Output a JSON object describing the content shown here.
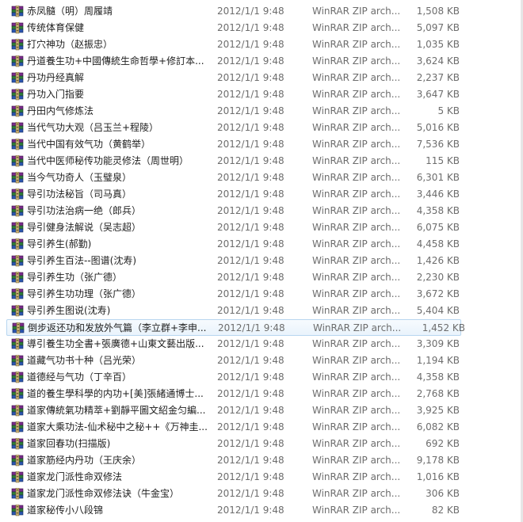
{
  "files": [
    {
      "name": "赤凤髓（明）周履靖",
      "date": "2012/1/1 9:48",
      "type": "WinRAR ZIP arch...",
      "size": "1,508 KB"
    },
    {
      "name": "传统体育保健",
      "date": "2012/1/1 9:48",
      "type": "WinRAR ZIP arch...",
      "size": "5,097 KB"
    },
    {
      "name": "打穴神功（赵振忠）",
      "date": "2012/1/1 9:48",
      "type": "WinRAR ZIP arch...",
      "size": "1,035 KB"
    },
    {
      "name": "丹道養生功+中國傳統生命哲學+修訂本...",
      "date": "2012/1/1 9:48",
      "type": "WinRAR ZIP arch...",
      "size": "3,624 KB"
    },
    {
      "name": "丹功丹经真解",
      "date": "2012/1/1 9:48",
      "type": "WinRAR ZIP arch...",
      "size": "2,237 KB"
    },
    {
      "name": "丹功入门指要",
      "date": "2012/1/1 9:48",
      "type": "WinRAR ZIP arch...",
      "size": "3,647 KB"
    },
    {
      "name": "丹田内气修炼法",
      "date": "2012/1/1 9:48",
      "type": "WinRAR ZIP arch...",
      "size": "5 KB"
    },
    {
      "name": "当代气功大观（吕玉兰+程陵）",
      "date": "2012/1/1 9:48",
      "type": "WinRAR ZIP arch...",
      "size": "5,016 KB"
    },
    {
      "name": "当代中国有效气功（黄鹤举）",
      "date": "2012/1/1 9:48",
      "type": "WinRAR ZIP arch...",
      "size": "7,536 KB"
    },
    {
      "name": "当代中医师秘传功能灵修法（周世明）",
      "date": "2012/1/1 9:48",
      "type": "WinRAR ZIP arch...",
      "size": "115 KB"
    },
    {
      "name": "当今气功奇人（玉璧泉）",
      "date": "2012/1/1 9:48",
      "type": "WinRAR ZIP arch...",
      "size": "6,301 KB"
    },
    {
      "name": "导引功法秘旨（司马真）",
      "date": "2012/1/1 9:48",
      "type": "WinRAR ZIP arch...",
      "size": "3,446 KB"
    },
    {
      "name": "导引功法治病一绝（郎兵）",
      "date": "2012/1/1 9:48",
      "type": "WinRAR ZIP arch...",
      "size": "4,358 KB"
    },
    {
      "name": "导引健身法解说（吴志超）",
      "date": "2012/1/1 9:48",
      "type": "WinRAR ZIP arch...",
      "size": "6,075 KB"
    },
    {
      "name": "导引养生(郝勤)",
      "date": "2012/1/1 9:48",
      "type": "WinRAR ZIP arch...",
      "size": "4,458 KB"
    },
    {
      "name": "导引养生百法--图谱(沈寿)",
      "date": "2012/1/1 9:48",
      "type": "WinRAR ZIP arch...",
      "size": "1,426 KB"
    },
    {
      "name": "导引养生功（张广德）",
      "date": "2012/1/1 9:48",
      "type": "WinRAR ZIP arch...",
      "size": "2,230 KB"
    },
    {
      "name": "导引养生功功理（张广德）",
      "date": "2012/1/1 9:48",
      "type": "WinRAR ZIP arch...",
      "size": "3,672 KB"
    },
    {
      "name": "导引养生图说(沈寿)",
      "date": "2012/1/1 9:48",
      "type": "WinRAR ZIP arch...",
      "size": "5,404 KB"
    },
    {
      "name": "倒步返还功和发放外气篇（李立群+李申...",
      "date": "2012/1/1 9:48",
      "type": "WinRAR ZIP arch...",
      "size": "1,452 KB"
    },
    {
      "name": "導引養生功全書+張廣德+山東文藝出版...",
      "date": "2012/1/1 9:48",
      "type": "WinRAR ZIP arch...",
      "size": "3,309 KB"
    },
    {
      "name": "道藏气功书十种（吕光荣）",
      "date": "2012/1/1 9:48",
      "type": "WinRAR ZIP arch...",
      "size": "1,194 KB"
    },
    {
      "name": "道德经与气功（丁辛百）",
      "date": "2012/1/1 9:48",
      "type": "WinRAR ZIP arch...",
      "size": "4,358 KB"
    },
    {
      "name": "道的養生學科學的内功+[美]張緒通博士...",
      "date": "2012/1/1 9:48",
      "type": "WinRAR ZIP arch...",
      "size": "2,768 KB"
    },
    {
      "name": "道家傳統氣功精萃+劉靜平圖文紹金匀編...",
      "date": "2012/1/1 9:48",
      "type": "WinRAR ZIP arch...",
      "size": "3,925 KB"
    },
    {
      "name": "道家大乘功法-仙术秘中之秘++《万神圭...",
      "date": "2012/1/1 9:48",
      "type": "WinRAR ZIP arch...",
      "size": "6,082 KB"
    },
    {
      "name": "道家回春功(扫描版)",
      "date": "2012/1/1 9:48",
      "type": "WinRAR ZIP arch...",
      "size": "692 KB"
    },
    {
      "name": "道家筋经内丹功（王庆余）",
      "date": "2012/1/1 9:48",
      "type": "WinRAR ZIP arch...",
      "size": "9,178 KB"
    },
    {
      "name": "道家龙门派性命双修法",
      "date": "2012/1/1 9:48",
      "type": "WinRAR ZIP arch...",
      "size": "1,016 KB"
    },
    {
      "name": "道家龙门派性命双修法诀（牛金宝）",
      "date": "2012/1/1 9:48",
      "type": "WinRAR ZIP arch...",
      "size": "306 KB"
    },
    {
      "name": "道家秘传小八段锦",
      "date": "2012/1/1 9:48",
      "type": "WinRAR ZIP arch...",
      "size": "82 KB"
    }
  ],
  "hover_index": 19,
  "icon": "winrar-archive-icon"
}
